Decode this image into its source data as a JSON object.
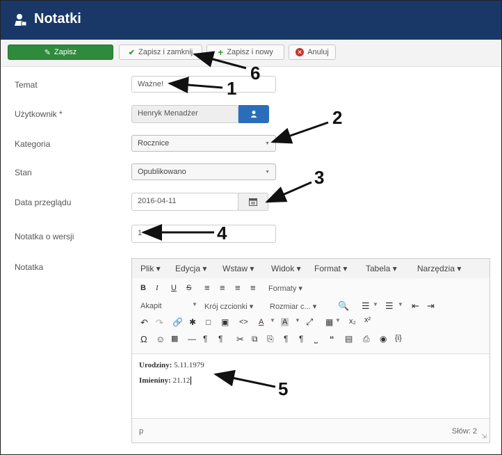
{
  "header": {
    "title": "Notatki"
  },
  "toolbar": {
    "save": "Zapisz",
    "save_close": "Zapisz i zamknij",
    "save_new": "Zapisz i nowy",
    "cancel": "Anuluj"
  },
  "form": {
    "subject": {
      "label": "Temat",
      "value": "Ważne!"
    },
    "user": {
      "label": "Użytkownik *",
      "value": "Henryk Menadżer"
    },
    "category": {
      "label": "Kategoria",
      "value": "Rocznice"
    },
    "state": {
      "label": "Stan",
      "value": "Opublikowano"
    },
    "review_date": {
      "label": "Data przeglądu",
      "value": "2016-04-11"
    },
    "version_note": {
      "label": "Notatka o wersji",
      "value": "1"
    },
    "note": {
      "label": "Notatka"
    }
  },
  "editor": {
    "menu": [
      "Plik ▾",
      "Edycja ▾",
      "Wstaw ▾",
      "Widok ▾",
      "Format ▾",
      "Tabela ▾",
      "Narzędzia ▾"
    ],
    "formats": "Formaty ▾",
    "paragraph": "Akapit",
    "font_family": "Krój czcionki ▾",
    "font_size": "Rozmiar c... ▾",
    "content": {
      "line1_label": "Urodziny:",
      "line1_value": " 5.11.1979",
      "line2_label": "Imieniny:",
      "line2_value": " 21.12"
    },
    "status_path": "p",
    "word_count": "Słów: 2"
  },
  "annotations": [
    "1",
    "2",
    "3",
    "4",
    "5",
    "6"
  ]
}
